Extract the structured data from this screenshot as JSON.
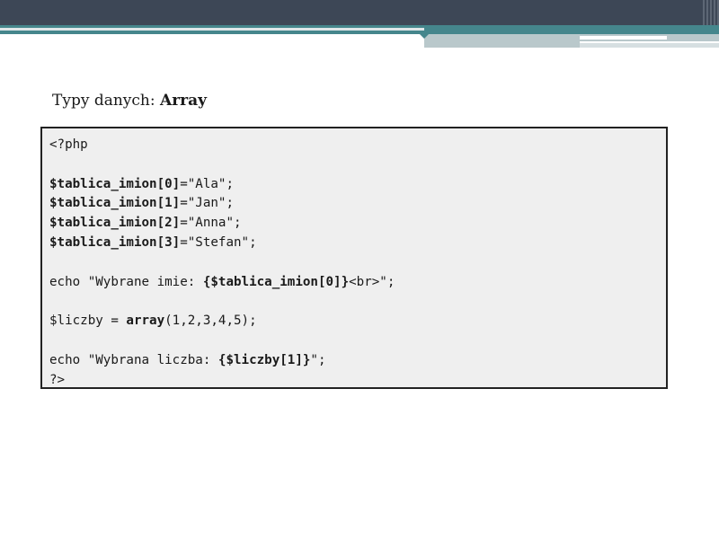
{
  "slide": {
    "title_prefix": "Typy danych: ",
    "title_bold": "Array"
  },
  "code": {
    "lines": [
      [
        {
          "t": "<?php",
          "b": false
        }
      ],
      [],
      [
        {
          "t": "$tablica_imion[0]",
          "b": true
        },
        {
          "t": "=\"Ala\";",
          "b": false
        }
      ],
      [
        {
          "t": "$tablica_imion[1]",
          "b": true
        },
        {
          "t": "=\"Jan\";",
          "b": false
        }
      ],
      [
        {
          "t": "$tablica_imion[2]",
          "b": true
        },
        {
          "t": "=\"Anna\";",
          "b": false
        }
      ],
      [
        {
          "t": "$tablica_imion[3]",
          "b": true
        },
        {
          "t": "=\"Stefan\";",
          "b": false
        }
      ],
      [],
      [
        {
          "t": "echo \"Wybrane imie: ",
          "b": false
        },
        {
          "t": "{$tablica_imion[0]}",
          "b": true
        },
        {
          "t": "<br>\";",
          "b": false
        }
      ],
      [],
      [
        {
          "t": "$liczby = ",
          "b": false
        },
        {
          "t": "array",
          "b": true
        },
        {
          "t": "(1,2,3,4,5);",
          "b": false
        }
      ],
      [],
      [
        {
          "t": "echo \"Wybrana liczba: ",
          "b": false
        },
        {
          "t": "{$liczby[1]}",
          "b": true
        },
        {
          "t": "\";",
          "b": false
        }
      ],
      [
        {
          "t": "?>",
          "b": false
        }
      ]
    ]
  },
  "colors": {
    "header_dark": "#3d4756",
    "header_teal": "#45868c",
    "code_background": "#efefef"
  }
}
